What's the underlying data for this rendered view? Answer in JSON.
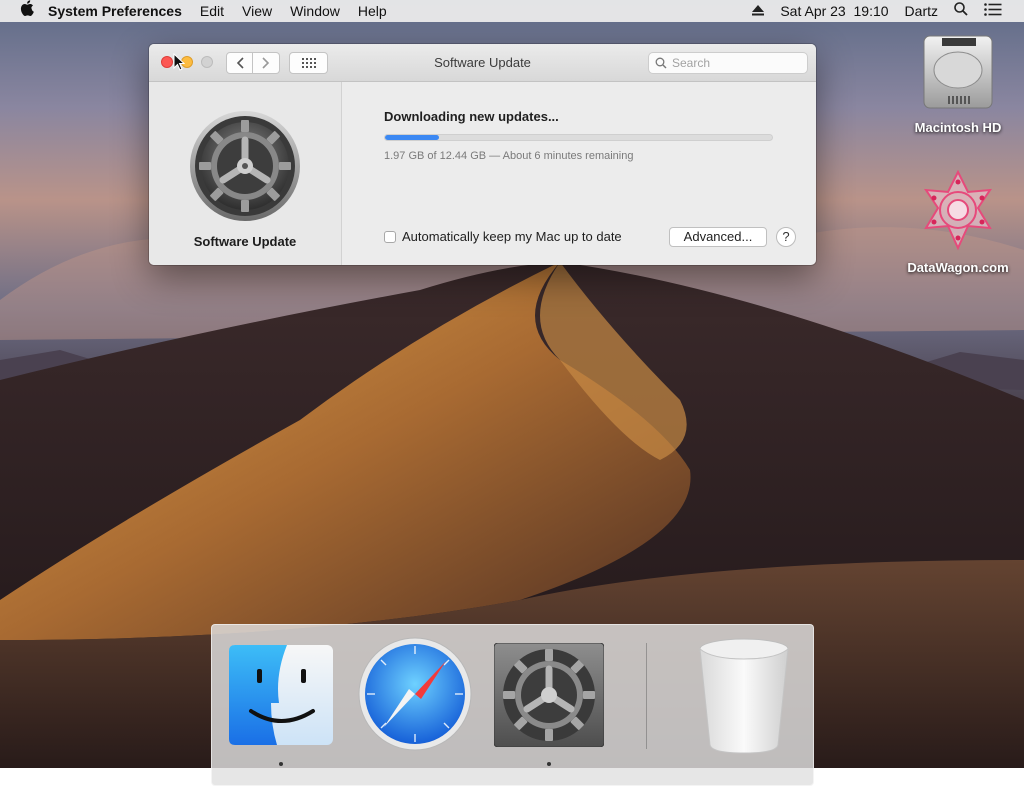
{
  "menubar": {
    "apple_icon": "apple-logo-icon",
    "app_name": "System Preferences",
    "menus": [
      "Edit",
      "View",
      "Window",
      "Help"
    ],
    "datetime": "Sat Apr 23  19:10",
    "user": "Dartz"
  },
  "window": {
    "title": "Software Update",
    "search_placeholder": "Search",
    "sidebar_label": "Software Update",
    "status_title": "Downloading new updates...",
    "progress_fraction": 0.14,
    "progress_detail": "1.97 GB of 12.44 GB — About 6 minutes remaining",
    "auto_update_label": "Automatically keep my Mac up to date",
    "auto_update_checked": false,
    "advanced_label": "Advanced...",
    "help_label": "?"
  },
  "desktop_icons": [
    {
      "label": "Macintosh HD",
      "icon": "hard-drive-icon"
    },
    {
      "label": "DataWagon.com",
      "icon": "mandala-icon"
    }
  ],
  "dock": [
    {
      "name": "Finder",
      "icon": "finder-icon",
      "running": true
    },
    {
      "name": "Safari",
      "icon": "safari-icon",
      "running": false
    },
    {
      "name": "System Preferences",
      "icon": "system-preferences-icon",
      "running": true
    },
    {
      "name": "Trash",
      "icon": "trash-icon",
      "running": false
    }
  ],
  "colors": {
    "accent": "#3b88f3",
    "close": "#fc5753",
    "minimize": "#fdbc40"
  }
}
